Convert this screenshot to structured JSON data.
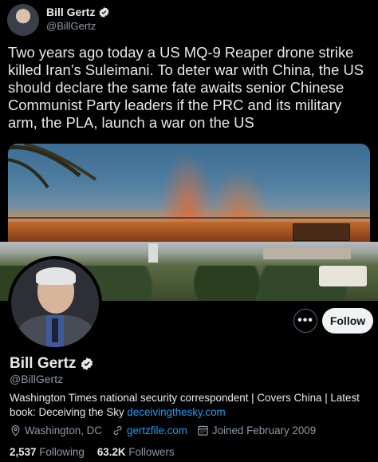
{
  "tweet": {
    "author_name": "Bill Gertz",
    "author_handle": "@BillGertz",
    "text": "Two years ago today a US MQ-9 Reaper drone strike killed Iran’s Suleimani. To deter war with China, the US should declare the same fate awaits senior Chinese Communist Party leaders if the PRC and its military arm, the PLA, launch a war on the US"
  },
  "profile": {
    "name": "Bill Gertz",
    "handle": "@BillGertz",
    "bio_text": "Washington Times national security correspondent | Covers China | Latest book: Deceiving the Sky ",
    "bio_link": "deceivingthesky.com",
    "location": "Washington, DC",
    "website": "gertzfile.com",
    "joined": "Joined February 2009",
    "following_count": "2,537",
    "following_label": "Following",
    "followers_count": "63.2K",
    "followers_label": "Followers",
    "follow_button": "Follow",
    "more_button": "•••"
  },
  "icons": {
    "verified": "verified-badge-icon",
    "location": "location-pin-icon",
    "link": "link-icon",
    "calendar": "calendar-icon",
    "more": "more-options-icon"
  },
  "colors": {
    "accent": "#1d9bf0",
    "background": "#000000",
    "text_primary": "#e7e9ea",
    "text_secondary": "#8b98a5",
    "follow_button_bg": "#eff3f4"
  }
}
